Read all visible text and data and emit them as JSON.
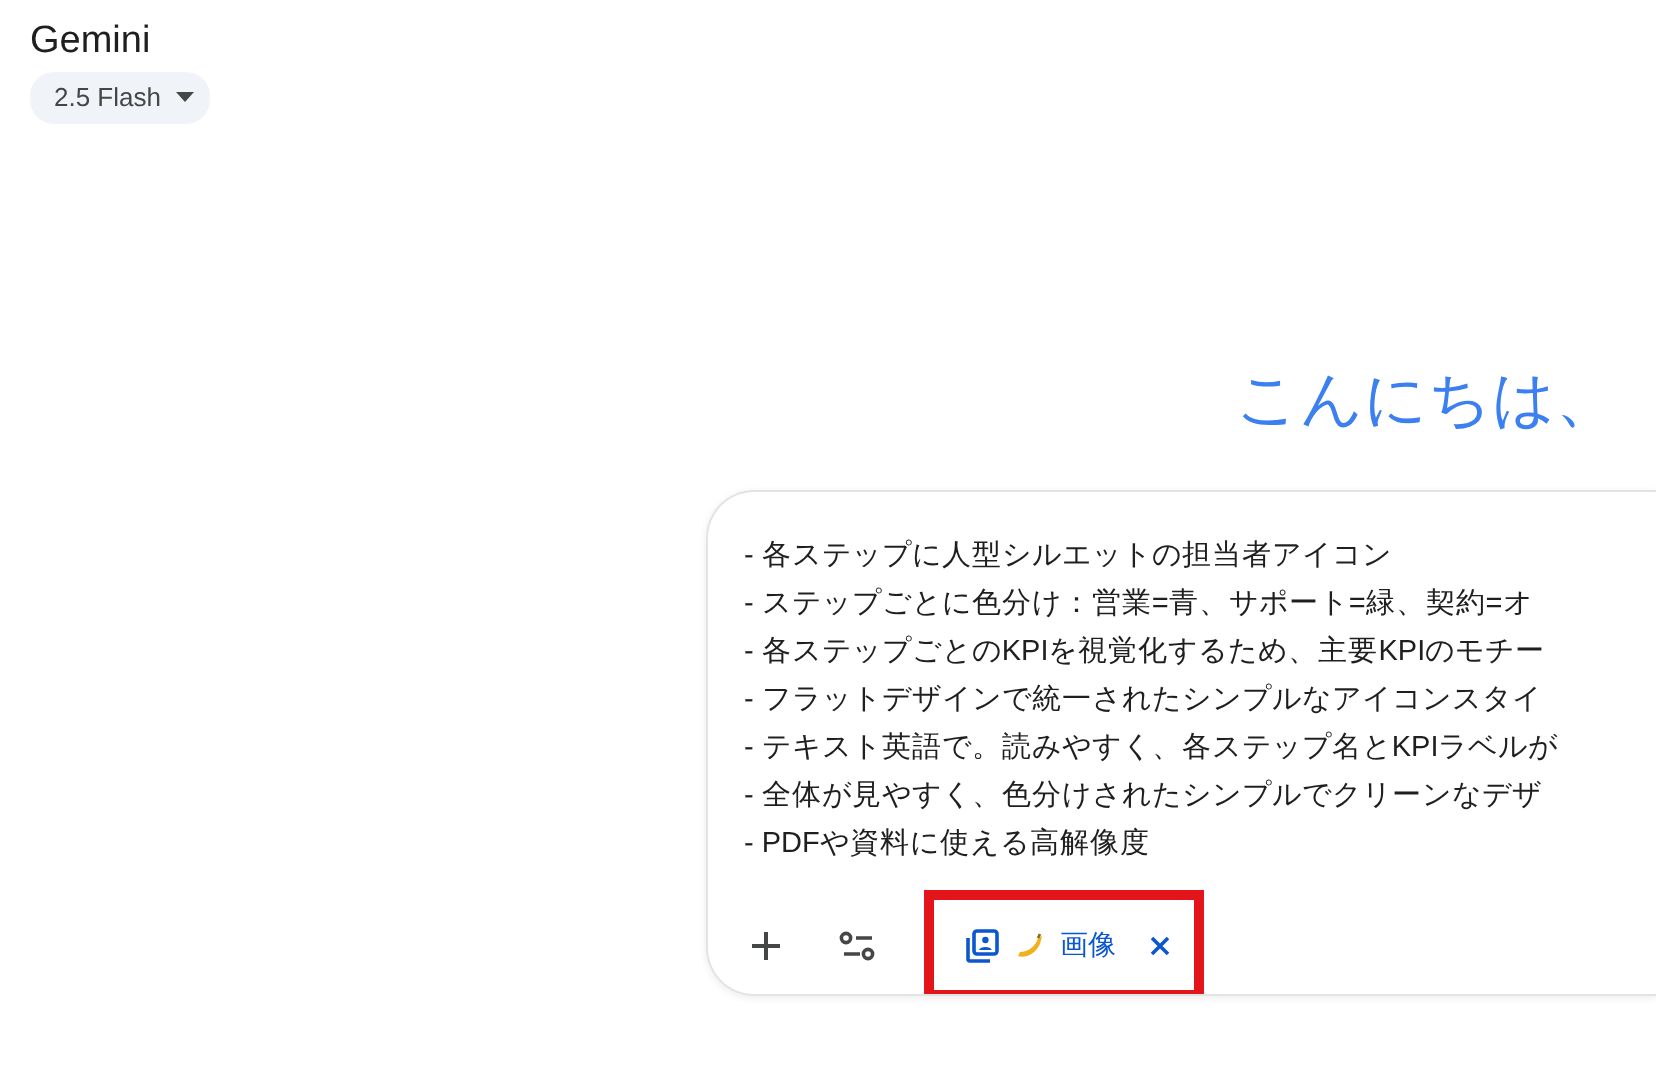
{
  "app": {
    "title": "Gemini",
    "model": "2.5 Flash"
  },
  "greeting": "こんにちは、",
  "prompt": {
    "lines": [
      "- 各ステップに人型シルエットの担当者アイコン",
      "- ステップごとに色分け：営業=青、サポート=緑、契約=オ",
      "- 各ステップごとのKPIを視覚化するため、主要KPIのモチー",
      "- フラットデザインで統一されたシンプルなアイコンスタイ",
      "- テキスト英語で。読みやすく、各ステップ名とKPIラベルが",
      "- 全体が見やすく、色分けされたシンプルでクリーンなデザ",
      "- PDFや資料に使える高解像度"
    ]
  },
  "tool_chip": {
    "label": "画像",
    "highlighted": true
  }
}
